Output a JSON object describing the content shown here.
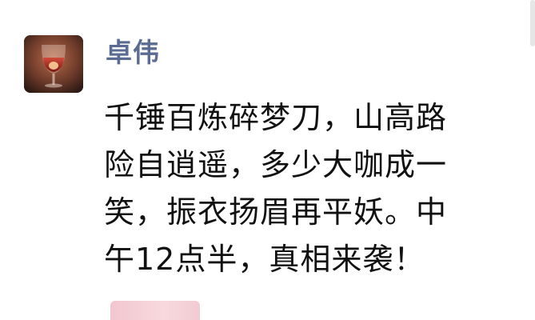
{
  "post": {
    "author_name": "卓伟",
    "avatar_icon": "wine-glass-avatar",
    "text_lines": [
      "千锤百炼碎梦刀，山高路",
      "险自逍遥，多少大咖成一",
      "笑，振衣扬眉再平妖。中",
      "午12点半，真相来袭！"
    ]
  },
  "next_post": {
    "avatar_color": "#f3c6cf"
  },
  "colors": {
    "name": "#5b6b93",
    "text": "#111111",
    "background": "#ffffff"
  }
}
